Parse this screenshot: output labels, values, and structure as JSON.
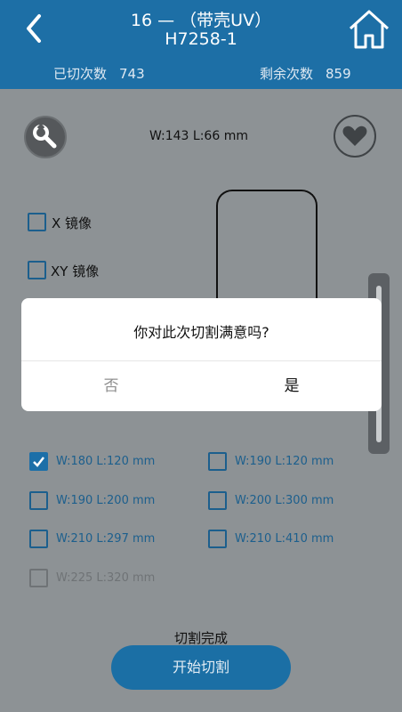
{
  "header": {
    "title_line1": "16 — （带壳UV）",
    "title_line2": "H7258-1",
    "cut_count_label": "已切次数",
    "cut_count_value": "743",
    "remaining_label": "剩余次数",
    "remaining_value": "859"
  },
  "main": {
    "current_size": "W:143 L:66 mm",
    "mirror_x_label": "X 镜像",
    "mirror_xy_label": "XY 镜像"
  },
  "size_options": [
    {
      "label": "W:180 L:120 mm",
      "checked": true
    },
    {
      "label": "W:190 L:120 mm",
      "checked": false
    },
    {
      "label": "W:190 L:200 mm",
      "checked": false
    },
    {
      "label": "W:200 L:300 mm",
      "checked": false
    },
    {
      "label": "W:210 L:297 mm",
      "checked": false
    },
    {
      "label": "W:210 L:410 mm",
      "checked": false
    },
    {
      "label": "W:225 L:320 mm",
      "checked": false,
      "disabled": true
    }
  ],
  "dialog": {
    "message": "你对此次切割满意吗?",
    "no_label": "否",
    "yes_label": "是"
  },
  "footer": {
    "status": "切割完成",
    "start_label": "开始切割"
  },
  "colors": {
    "header_bg": "#1d6fa6",
    "accent": "#1b6fa5",
    "overlay_bg": "#8d9295"
  }
}
